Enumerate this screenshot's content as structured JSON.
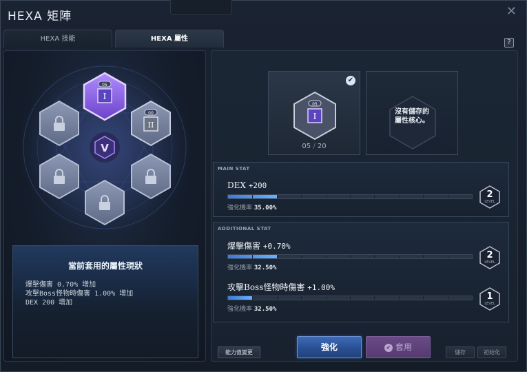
{
  "window": {
    "title": "HEXA 矩陣",
    "close_glyph": "✕"
  },
  "tabs": [
    {
      "label": "HEXA 技能",
      "selected": false
    },
    {
      "label": "HEXA 屬性",
      "selected": true
    }
  ],
  "help_label": "?",
  "hex_map": {
    "top_node_level": "05",
    "top_node_numeral": "I",
    "right_node_level": "00",
    "right_node_numeral": "II",
    "center_symbol": "V",
    "locked_icon": "lock-icon"
  },
  "summary": {
    "title": "當前套用的屬性現狀",
    "lines": [
      "爆擊傷害 0.70% 增加",
      "攻擊Boss怪物時傷害 1.00% 增加",
      "DEX 200 增加"
    ]
  },
  "core_slots": {
    "active": {
      "level": "05",
      "numeral": "I",
      "current": "05",
      "separator": "/",
      "max": "20",
      "checked": true
    },
    "empty": {
      "text_line1": "沒有儲存的",
      "text_line2": "屬性核心。"
    }
  },
  "main_stat": {
    "header": "MAIN STAT",
    "name": "DEX",
    "value": "+200",
    "rate_label": "強化機率",
    "rate_value": "35.00%",
    "level": "2",
    "level_word": "LEVEL",
    "progress": 0.2
  },
  "additional_stat": {
    "header": "ADDITIONAL STAT",
    "stats": [
      {
        "name": "爆擊傷害",
        "value": "+0.70%",
        "rate_label": "強化機率",
        "rate_value": "32.50%",
        "level": "2",
        "level_word": "LEVEL",
        "progress": 0.2
      },
      {
        "name": "攻擊Boss怪物時傷害",
        "value": "+1.00%",
        "rate_label": "強化機率",
        "rate_value": "32.50%",
        "level": "1",
        "level_word": "LEVEL",
        "progress": 0.1
      }
    ]
  },
  "buttons": {
    "change": "能力值變更",
    "enhance": "強化",
    "apply": "套用",
    "save": "儲存",
    "init": "初始化"
  },
  "colors": {
    "accent_blue": "#3d7bd6",
    "active_purple": "#9a6cff",
    "apply_purple": "#6a4a86"
  }
}
